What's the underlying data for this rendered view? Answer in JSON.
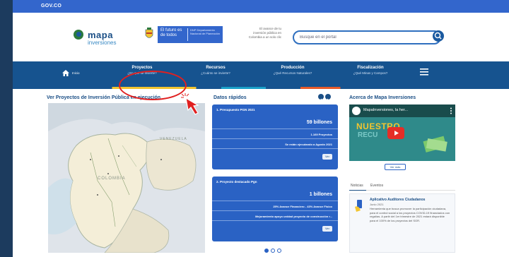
{
  "gov_bar": {
    "logo_text": "GOV.CO"
  },
  "header": {
    "logo_title": "mapa",
    "logo_subtitle": "inversiones",
    "futuro_text": "El futuro es de todos",
    "futuro_entity": "DNP Departamento Nacional de Planeación",
    "tagline": "El avance de tu inversión pública en Colombia a un solo clic",
    "search_placeholder": "Busque en el portal"
  },
  "nav": {
    "home_label": "Inicio",
    "items": [
      {
        "title": "Proyectos",
        "sub": "¿En qué se invierte?"
      },
      {
        "title": "Recursos",
        "sub": "¿Cuánto se invierte?"
      },
      {
        "title": "Producción",
        "sub": "¿Qué Recursos Naturales?"
      },
      {
        "title": "Fiscalización",
        "sub": "¿Qué Minas y Campos?"
      }
    ]
  },
  "sections": {
    "map_title": "Ver Proyectos de Inversión Pública en ejecución",
    "data_title": "Datos rápidos",
    "about_title": "Acerca de Mapa Inversiones"
  },
  "map_labels": {
    "venezuela": "VENEZUELA",
    "colombia": "COLOMBIA"
  },
  "cards": [
    {
      "title": "1. Presupuesto PGN 2021",
      "big": "59 billones",
      "line1": "1.169 Proyectos",
      "line2": "Se están ejecutando a Agosto 2021",
      "btn": "Ver"
    },
    {
      "title": "2. Proyecto destacado Pgn",
      "big": "1 billones",
      "line1": "25% Avance Financiero - 43% Avance Físico",
      "line2": "Mejoramiento apoyo unidad proyecto de construcción r...",
      "btn": "Ver"
    }
  ],
  "video": {
    "title": "MapaInversiones, la her...",
    "overlay_line1": "NUESTRO",
    "overlay_line2": "RECU"
  },
  "about": {
    "ver_mas": "Ver más",
    "tabs": [
      "Noticias",
      "Eventos"
    ],
    "news_title": "Aplicativo Auditores Ciudadanos",
    "news_date": "Junio 2021",
    "news_body": "Herramienta que busca promover la participación ciudadana, para el control social a los proyectos COVID-19 financiados con regalías. A partir del 1er trimestre de 2021 estará disponible para el 100% de los proyectos del SGR."
  },
  "colors": {
    "gov_blue": "#3366cc",
    "nav_blue": "#16538f",
    "card_blue": "#2a62c4",
    "annotation_red": "#e02020"
  }
}
